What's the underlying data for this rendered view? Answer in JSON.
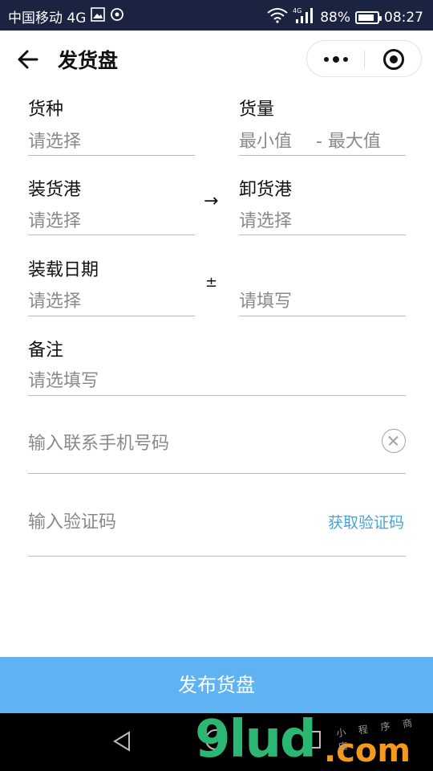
{
  "status_bar": {
    "carrier": "中国移动 4G",
    "network": "4G",
    "battery": "88%",
    "battery_level": 0.88,
    "time": "08:27"
  },
  "header": {
    "title": "发货盘"
  },
  "form": {
    "cargo_type": {
      "label": "货种",
      "placeholder": "请选择"
    },
    "quantity": {
      "label": "货量",
      "min_placeholder": "最小值",
      "max_placeholder": "- 最大值"
    },
    "load_port": {
      "label": "装货港",
      "placeholder": "请选择"
    },
    "arrow": "→",
    "unload_port": {
      "label": "卸货港",
      "placeholder": "请选择"
    },
    "load_date": {
      "label": "装载日期",
      "placeholder": "请选择"
    },
    "plusminus": "±",
    "date_range": {
      "placeholder": "请填写"
    },
    "remarks": {
      "label": "备注",
      "placeholder": "请选填写"
    },
    "phone": {
      "placeholder": "输入联系手机号码"
    },
    "code": {
      "placeholder": "输入验证码",
      "get_code": "获取验证码"
    }
  },
  "submit_label": "发布货盘",
  "watermark": {
    "main": "9lud",
    "dot_com": ".com",
    "small": "小 程 序 商 店"
  },
  "colors": {
    "accent": "#5fb3f3",
    "link": "#4aa3d9",
    "statusbar": "#1a2340"
  }
}
